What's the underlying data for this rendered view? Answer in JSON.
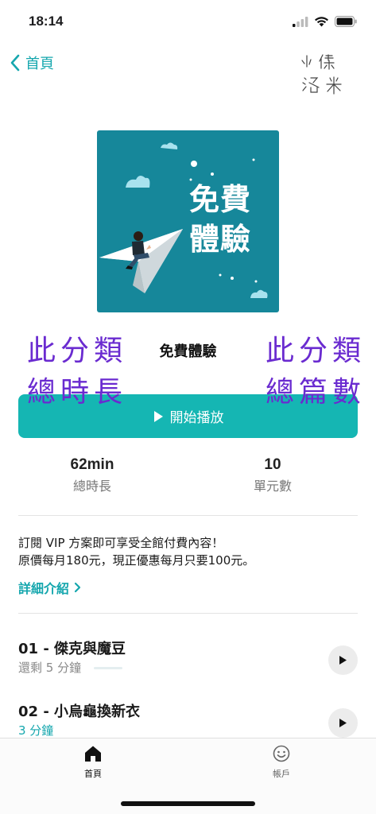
{
  "status_bar": {
    "time": "18:14"
  },
  "nav": {
    "back_label": "首頁",
    "handwriting": "小傑 洛米"
  },
  "cover": {
    "title_line1": "免費",
    "title_line2": "體驗"
  },
  "annotations": {
    "left_line1": "此分類",
    "left_line2": "總時長",
    "right_line1": "此分類",
    "right_line2": "總篇數",
    "color": "#6a2bd0"
  },
  "course": {
    "title": "免費體驗"
  },
  "play_button": {
    "label": "開始播放"
  },
  "stats": {
    "duration_value": "62min",
    "duration_label": "總時長",
    "units_value": "10",
    "units_label": "單元數"
  },
  "promo": {
    "line1": "訂閱 VIP 方案即可享受全館付費內容！",
    "line2": "原價每月180元，現正優惠每月只要100元。",
    "details_link": "詳細介紹"
  },
  "episodes": [
    {
      "title": "01 - 傑克與魔豆",
      "subtitle": "還剩 5 分鐘",
      "progress": 0.0
    },
    {
      "title": "02 - 小烏龜換新衣",
      "subtitle": "3 分鐘"
    }
  ],
  "tabs": [
    {
      "label": "首頁",
      "icon": "home-icon",
      "active": true
    },
    {
      "label": "帳戶",
      "icon": "smiley-icon",
      "active": false
    }
  ],
  "colors": {
    "accent": "#16a7ae",
    "button": "#15b6b3",
    "cover_bg": "#16879a"
  }
}
